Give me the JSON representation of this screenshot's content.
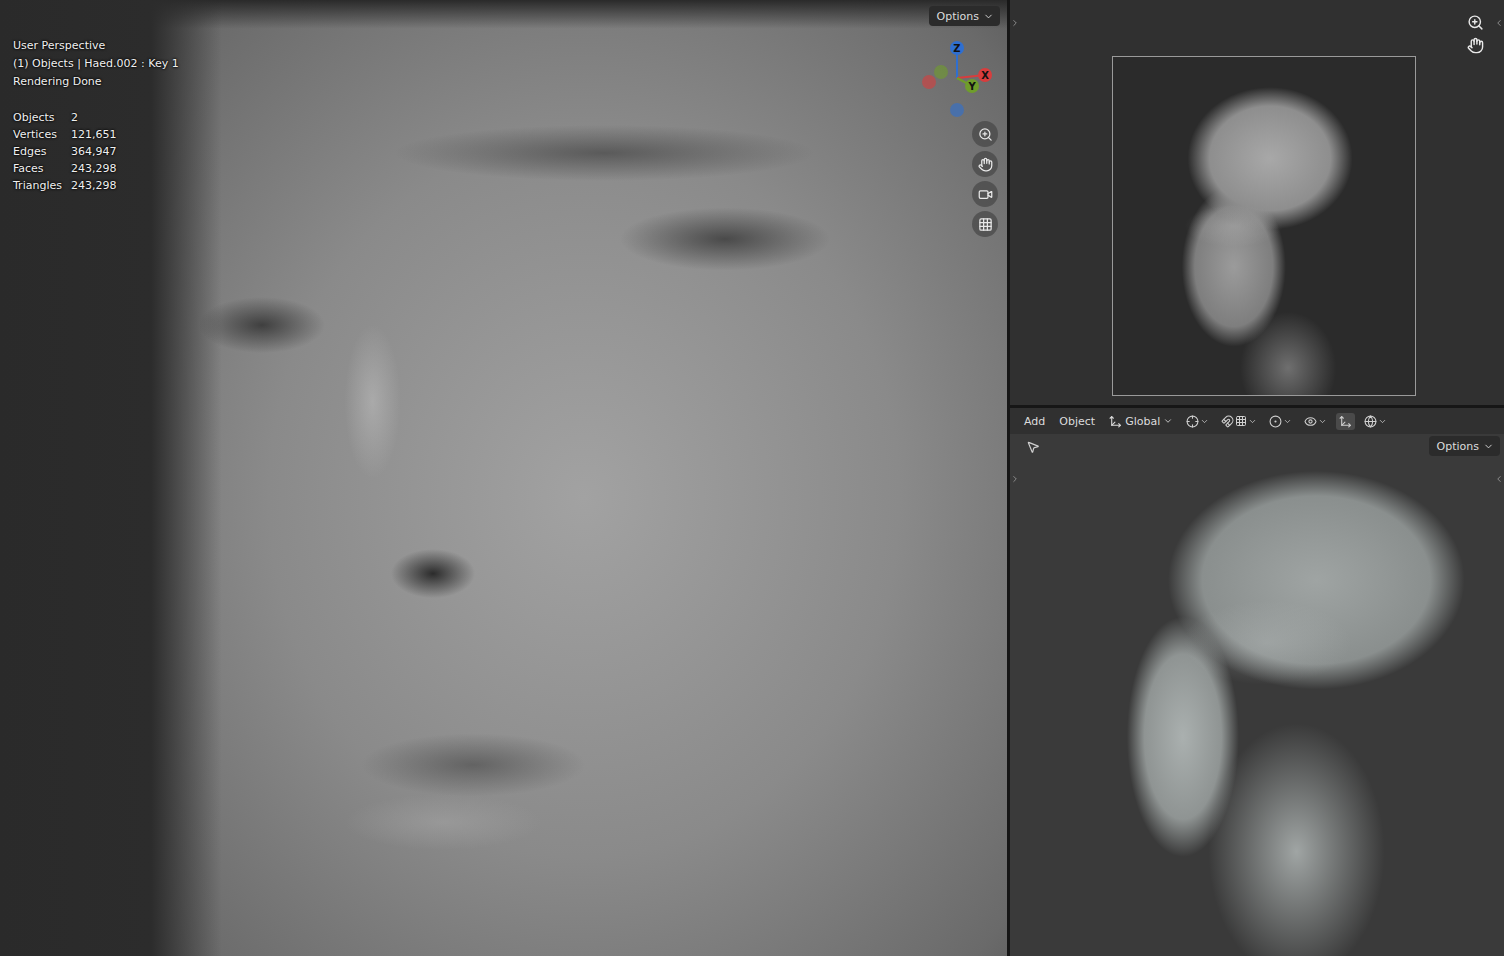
{
  "viewport": {
    "view": "User Perspective",
    "object_info": "(1) Objects | Haed.002 : Key 1",
    "status": "Rendering Done",
    "stats": [
      {
        "label": "Objects",
        "value": "2"
      },
      {
        "label": "Vertices",
        "value": "121,651"
      },
      {
        "label": "Edges",
        "value": "364,947"
      },
      {
        "label": "Faces",
        "value": "243,298"
      },
      {
        "label": "Triangles",
        "value": "243,298"
      }
    ],
    "options": "Options",
    "axes": [
      {
        "label": "Z",
        "color": "#2f6fd0"
      },
      {
        "label": "X",
        "color": "#d83d3d"
      },
      {
        "label": "Y",
        "color": "#6f9d2b"
      }
    ]
  },
  "header": {
    "menus": [
      "Add",
      "Object"
    ],
    "orientation": "Global"
  },
  "tool_row": {
    "options": "Options"
  }
}
